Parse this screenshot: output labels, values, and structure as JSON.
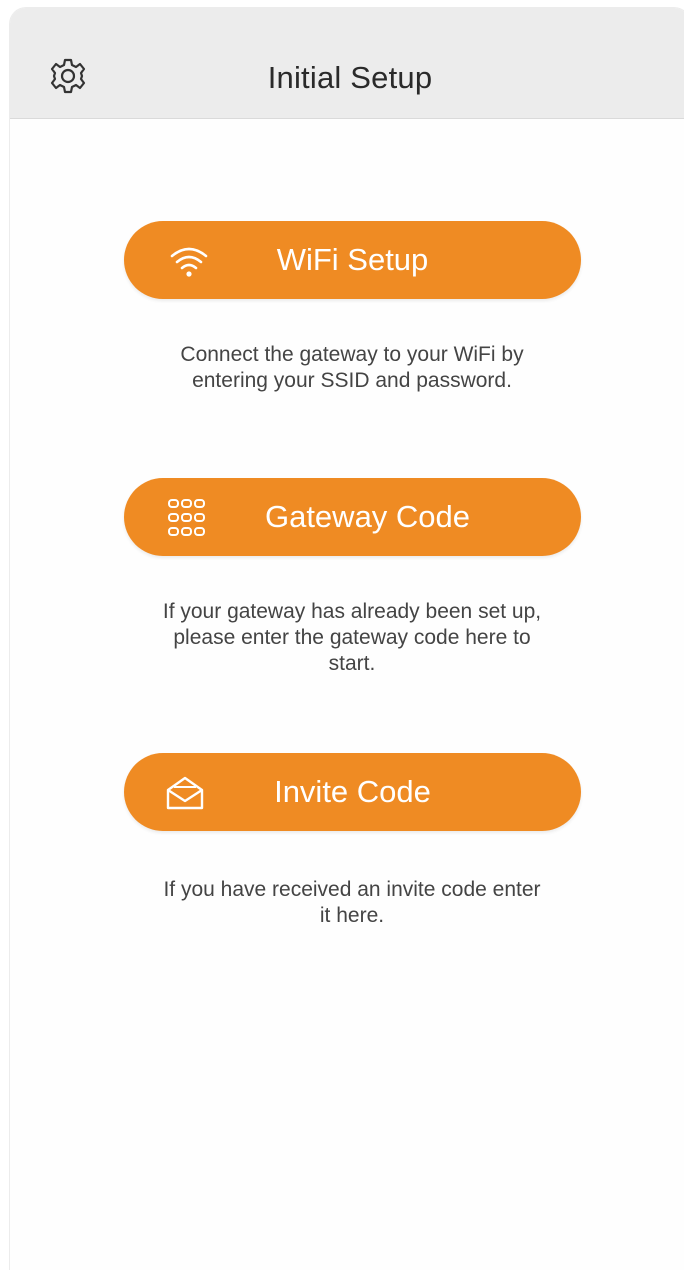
{
  "header": {
    "title": "Initial Setup",
    "settings_icon": "gear-icon"
  },
  "options": [
    {
      "label": "WiFi Setup",
      "icon": "wifi-icon",
      "description_lines": [
        "Connect the gateway to your WiFi by",
        "entering your SSID and password."
      ]
    },
    {
      "label": "Gateway Code",
      "icon": "keypad-icon",
      "description_lines": [
        "If your gateway has already been set up,",
        "please enter the gateway code here to",
        "start."
      ]
    },
    {
      "label": "Invite Code",
      "icon": "envelope-icon",
      "description_lines": [
        "If you have received an invite code enter",
        "it here."
      ]
    }
  ],
  "colors": {
    "accent": "#ef8b23",
    "header_bg": "#ececec",
    "text": "#444444"
  }
}
